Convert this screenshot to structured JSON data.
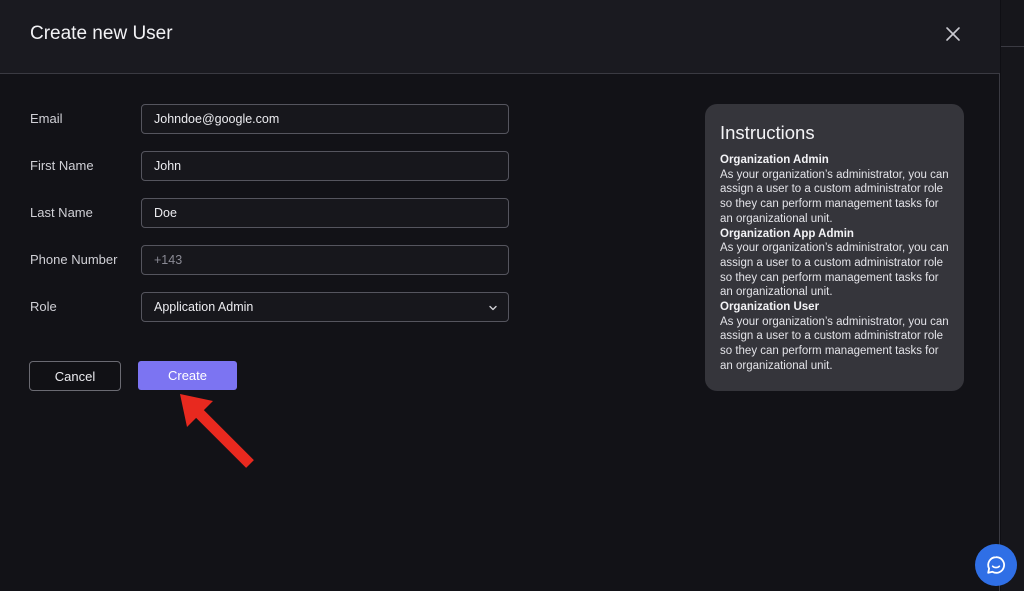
{
  "modal": {
    "title": "Create new User"
  },
  "form": {
    "email": {
      "label": "Email",
      "value": "Johndoe@google.com"
    },
    "first_name": {
      "label": "First Name",
      "value": "John"
    },
    "last_name": {
      "label": "Last Name",
      "value": "Doe"
    },
    "phone": {
      "label": "Phone Number",
      "value": "",
      "placeholder": "+143"
    },
    "role": {
      "label": "Role",
      "selected": "Application Admin"
    }
  },
  "buttons": {
    "cancel": "Cancel",
    "create": "Create"
  },
  "instructions": {
    "title": "Instructions",
    "roles": [
      {
        "name": "Organization Admin",
        "description": "As your organization’s administrator, you can assign a user to a custom administrator role so they can perform management tasks for an organizational unit."
      },
      {
        "name": "Organization App Admin",
        "description": "As your organization’s administrator, you can assign a user to a custom administrator role so they can perform management tasks for an organizational unit."
      },
      {
        "name": "Organization User",
        "description": "As your organization’s administrator, you can assign a user to a custom administrator role so they can perform management tasks for an organizational unit."
      }
    ]
  },
  "colors": {
    "accent": "#7c74f2",
    "annotation_arrow": "#e8291f",
    "chat_button": "#2f6fe6",
    "panel_bg": "#35353b"
  },
  "icons": {
    "close": "close-icon",
    "select": "chevron-down-icon",
    "chat": "chat-bubble-icon",
    "annotation": "arrow-annotation"
  }
}
